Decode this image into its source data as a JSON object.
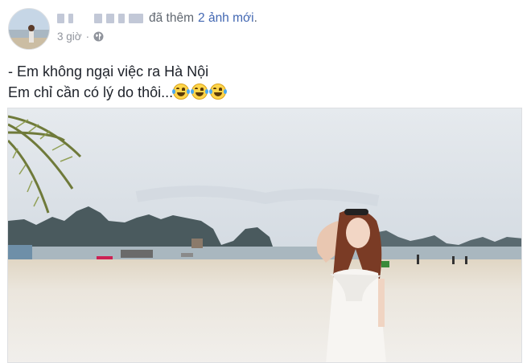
{
  "post": {
    "author_name_obscured": true,
    "action_text": "đã thêm",
    "link_text": "2 ảnh mới",
    "link_suffix": ".",
    "time": "3 giờ",
    "separator": "·",
    "privacy_icon": "globe-icon",
    "text_line_1": "- Em không ngại việc ra Hà Nội",
    "text_line_2": "Em chỉ cần có lý do thôi...",
    "emoji_icon": "tears-of-joy-emoji",
    "emoji_count": 3
  },
  "colors": {
    "link": "#4267b2",
    "meta": "#90949c",
    "text": "#1d2129"
  }
}
